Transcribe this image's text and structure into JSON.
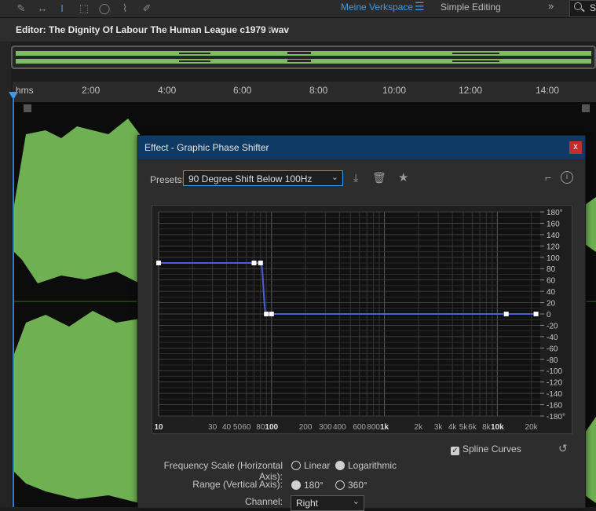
{
  "toolbar": {
    "workspace_active": "Meine Verkspace",
    "workspace_other": "Simple Editing",
    "search_text": "S"
  },
  "editor": {
    "title": "Editor: The Dignity Of Labour    The Human League c1979  .wav"
  },
  "ruler": {
    "labels": [
      "hms",
      "2:00",
      "4:00",
      "6:00",
      "8:00",
      "10:00",
      "12:00",
      "14:00"
    ]
  },
  "dialog": {
    "title": "Effect - Graphic Phase Shifter",
    "close_label": "x",
    "presets_label": "Presets:",
    "preset_value": "90 Degree Shift Below 100Hz",
    "spline_label": "Spline Curves",
    "freq_scale_label": "Frequency Scale (Horizontal Axis):",
    "freq_linear": "Linear",
    "freq_log": "Logarithmic",
    "range_label": "Range (Vertical Axis):",
    "range_180": "180°",
    "range_360": "360°",
    "channel_label": "Channel:",
    "channel_value": "Right"
  },
  "chart_data": {
    "type": "line",
    "x_scale": "log",
    "xlim": [
      10,
      24000
    ],
    "ylim": [
      -180,
      180
    ],
    "x_tick_labels": [
      "10",
      "30",
      "40",
      "50",
      "60",
      "80",
      "100",
      "200",
      "300",
      "400",
      "600",
      "800",
      "1k",
      "2k",
      "3k",
      "4k",
      "5k",
      "6k",
      "8k",
      "10k",
      "20k"
    ],
    "x_tick_values": [
      10,
      30,
      40,
      50,
      60,
      80,
      100,
      200,
      300,
      400,
      600,
      800,
      1000,
      2000,
      3000,
      4000,
      5000,
      6000,
      8000,
      10000,
      20000
    ],
    "y_tick_labels": [
      "180°",
      "160",
      "140",
      "120",
      "100",
      "80",
      "60",
      "40",
      "20",
      "0",
      "-20",
      "-40",
      "-60",
      "-80",
      "-100",
      "-120",
      "-140",
      "-160",
      "-180°"
    ],
    "y_tick_values": [
      180,
      160,
      140,
      120,
      100,
      80,
      60,
      40,
      20,
      0,
      -20,
      -40,
      -60,
      -80,
      -100,
      -120,
      -140,
      -160,
      -180
    ],
    "control_points": [
      {
        "x": 10,
        "y": 90
      },
      {
        "x": 70,
        "y": 90
      },
      {
        "x": 80,
        "y": 90
      },
      {
        "x": 90,
        "y": 0
      },
      {
        "x": 100,
        "y": 0
      },
      {
        "x": 12000,
        "y": 0
      },
      {
        "x": 22000,
        "y": 0
      }
    ],
    "curve_color": "#4a5fd8",
    "grid": true
  }
}
